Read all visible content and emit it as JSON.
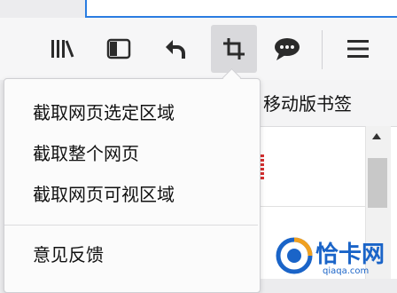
{
  "toolbar": {
    "buttons": [
      {
        "icon": "library-icon"
      },
      {
        "icon": "sidebar-icon"
      },
      {
        "icon": "back-arrow-icon"
      },
      {
        "icon": "screenshot-crop-icon",
        "active": true
      },
      {
        "icon": "chat-bubble-icon"
      },
      {
        "icon": "hamburger-menu-icon"
      }
    ]
  },
  "bookmarks_bar": {
    "label": "移动版书签"
  },
  "screenshot_menu": {
    "items": [
      {
        "label": "截取网页选定区域"
      },
      {
        "label": "截取整个网页"
      },
      {
        "label": "截取网页可视区域"
      }
    ],
    "feedback_label": "意见反馈"
  },
  "watermark": {
    "title": "恰卡网",
    "url": "qiaqa.com"
  },
  "colors": {
    "accent": "#2a7de1",
    "watermark_blue": "#1a64c8"
  }
}
